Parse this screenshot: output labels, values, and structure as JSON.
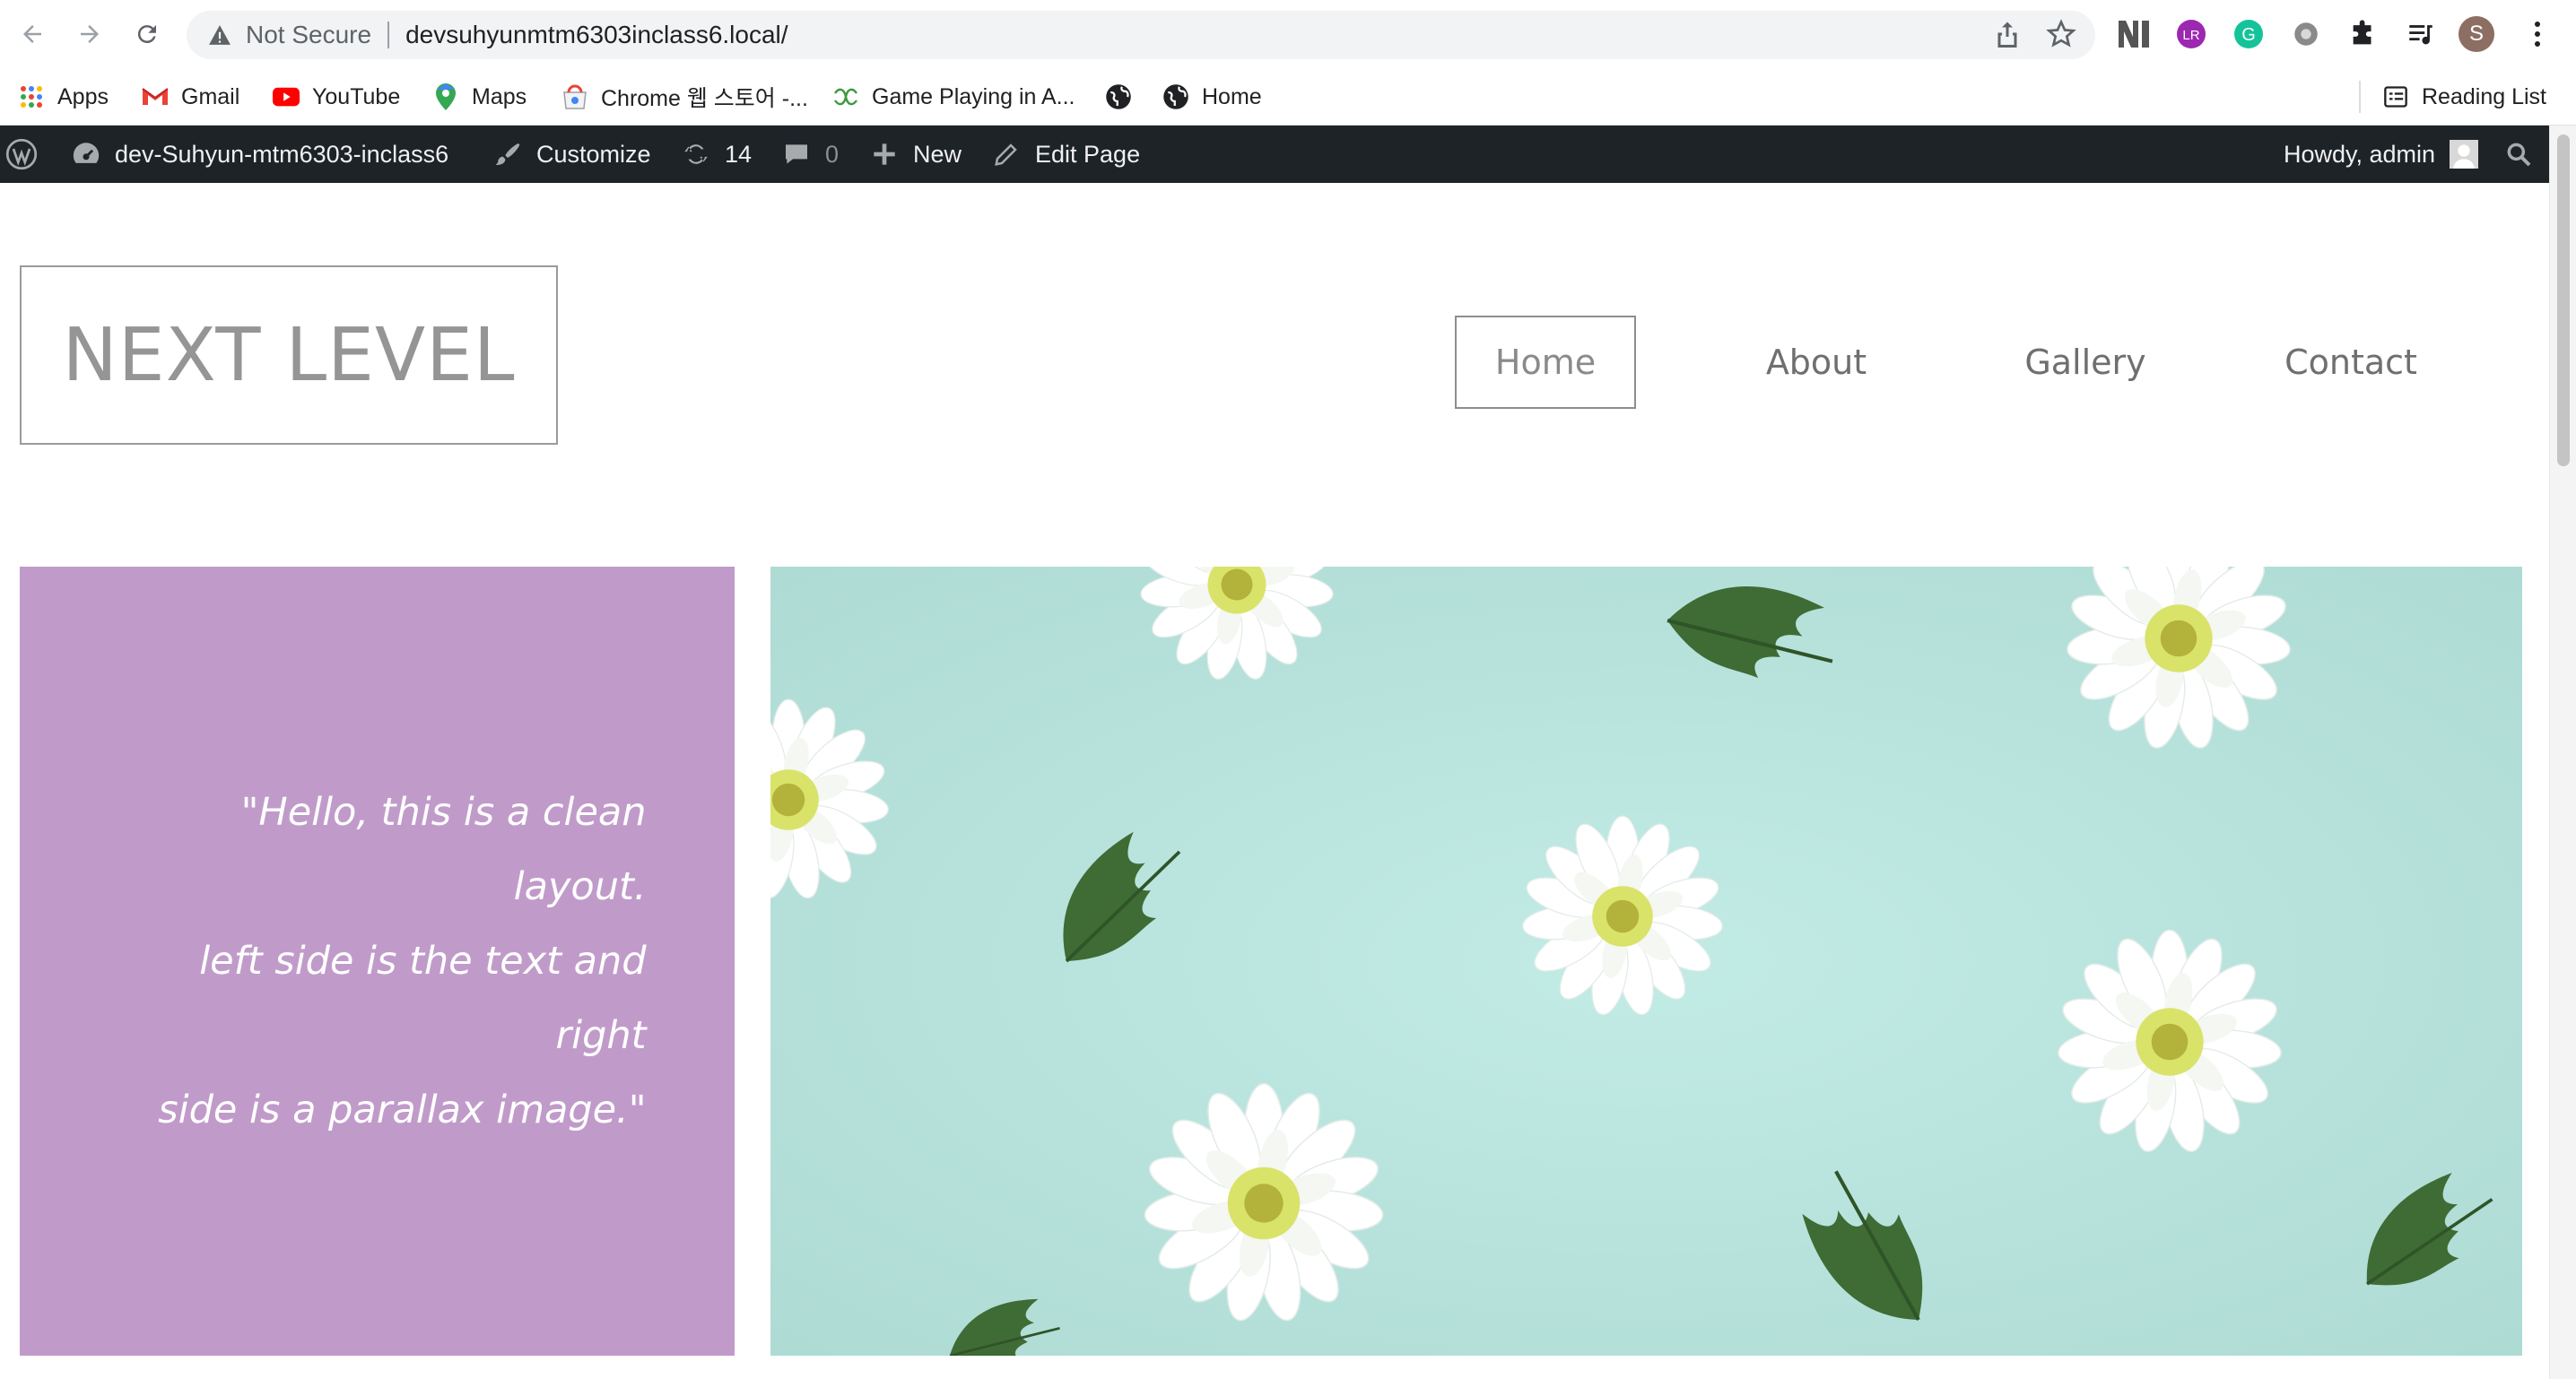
{
  "browser": {
    "security_label": "Not Secure",
    "url": "devsuhyunmtm6303inclass6.local/",
    "profile_initial": "S",
    "bookmarks": [
      {
        "label": "Apps",
        "icon": "apps-grid-icon"
      },
      {
        "label": "Gmail",
        "icon": "gmail-icon"
      },
      {
        "label": "YouTube",
        "icon": "youtube-icon"
      },
      {
        "label": "Maps",
        "icon": "maps-icon"
      },
      {
        "label": "Chrome 웹 스토어 -...",
        "icon": "chrome-store-icon"
      },
      {
        "label": "Game Playing in A...",
        "icon": "game-link-icon"
      },
      {
        "label": "",
        "icon": "globe-icon"
      },
      {
        "label": "Home",
        "icon": "globe-icon"
      }
    ],
    "reading_list": "Reading List"
  },
  "adminbar": {
    "site_name": "dev-Suhyun-mtm6303-inclass6",
    "customize": "Customize",
    "updates": "14",
    "comments": "0",
    "new": "New",
    "edit_page": "Edit Page",
    "howdy": "Howdy, admin"
  },
  "site": {
    "logo": "NEXT LEVEL",
    "nav": [
      "Home",
      "About",
      "Gallery",
      "Contact"
    ],
    "active_nav": "Home",
    "quote_lines": [
      "\"Hello, this is a clean layout.",
      "left side is the text and right",
      "side is a parallax image.\""
    ]
  },
  "colors": {
    "adminbar_bg": "#1d2327",
    "quote_panel_bg": "#c09bca",
    "hero_bg": "#b4e2dc"
  }
}
